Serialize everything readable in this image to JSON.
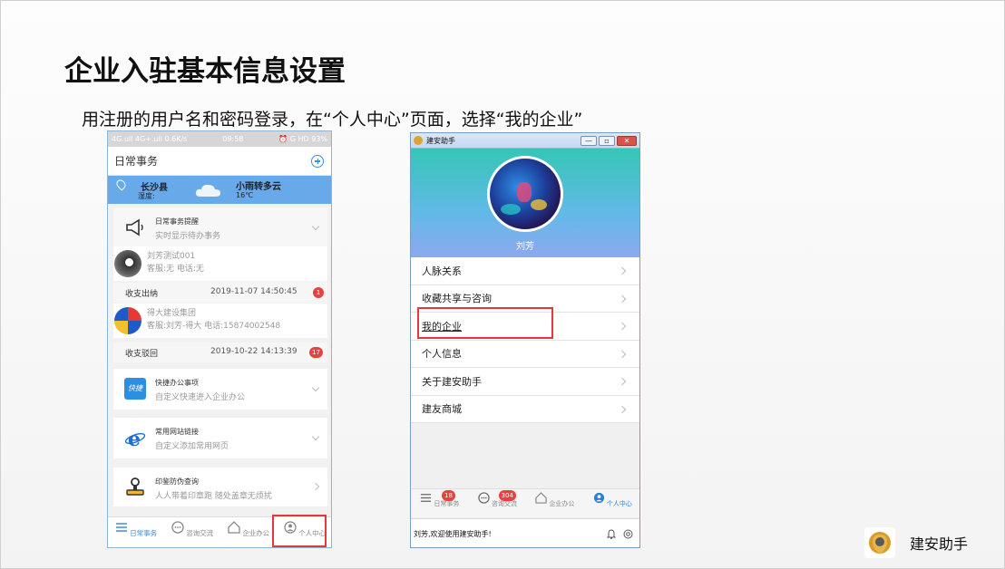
{
  "slide": {
    "title": "企业入驻基本信息设置",
    "subtitle": "用注册的用户名和密码登录，在“个人中心”页面，选择“我的企业”"
  },
  "left_phone": {
    "status_left": "4G.ull 4G+.ull 0.6K/s",
    "status_time": "09:58",
    "status_right": "⏰ G HD 93%",
    "nav_title": "日常事务",
    "weather": {
      "county": "长沙县",
      "humidity_label": "湿度:",
      "condition": "小雨转多云",
      "temperature": "16℃"
    },
    "cards": [
      {
        "title": "日常事务提醒",
        "subtitle": "实时显示待办事务",
        "icon": "megaphone-icon"
      },
      {
        "title": "快捷办公事项",
        "subtitle": "自定义快速进入企业办公",
        "icon": "shortcut-icon",
        "icon_text": "快捷"
      },
      {
        "title": "常用网站链接",
        "subtitle": "自定义添加常用网页",
        "icon": "ie-browser-icon"
      },
      {
        "title": "印鉴防伪查询",
        "subtitle": "人人带着印章跑 随处盖章无烦扰",
        "icon": "stamp-icon"
      }
    ],
    "messages": [
      {
        "line1": "刘芳测试001",
        "line2": "客服:无 电话:无",
        "type": "收支出纳",
        "time": "2019-11-07 14:50:45",
        "badge": "1"
      },
      {
        "line1": "得大建设集团",
        "line2": "客服:刘芳-得大 电话:15874002548",
        "type": "收支驳回",
        "time": "2019-10-22 14:13:39",
        "badge": "17"
      }
    ],
    "tabs": [
      "日常事务",
      "咨询交流",
      "企业办公",
      "个人中心"
    ],
    "active_tab": "个人中心"
  },
  "right_phone": {
    "window_title": "建安助手",
    "window_buttons": [
      "—",
      "▫",
      "✕"
    ],
    "user_name": "刘芳",
    "menu_items": [
      "人脉关系",
      "收藏共享与咨询",
      "我的企业",
      "个人信息",
      "关于建安助手",
      "建友商城"
    ],
    "highlighted_item": "我的企业",
    "tabs": [
      {
        "label": "日常事务",
        "badge": "18"
      },
      {
        "label": "咨询交流",
        "badge": "304"
      },
      {
        "label": "企业办公",
        "badge": ""
      },
      {
        "label": "个人中心",
        "badge": ""
      }
    ],
    "active_tab": "个人中心",
    "footer_text": "刘芳,欢迎使用建安助手!"
  },
  "brand": {
    "name": "建安助手"
  },
  "colors": {
    "accent": "#3a8ee6",
    "highlight_box": "#e03a3a",
    "weather_bar": "#68a9ea",
    "badge": "#e64340"
  }
}
